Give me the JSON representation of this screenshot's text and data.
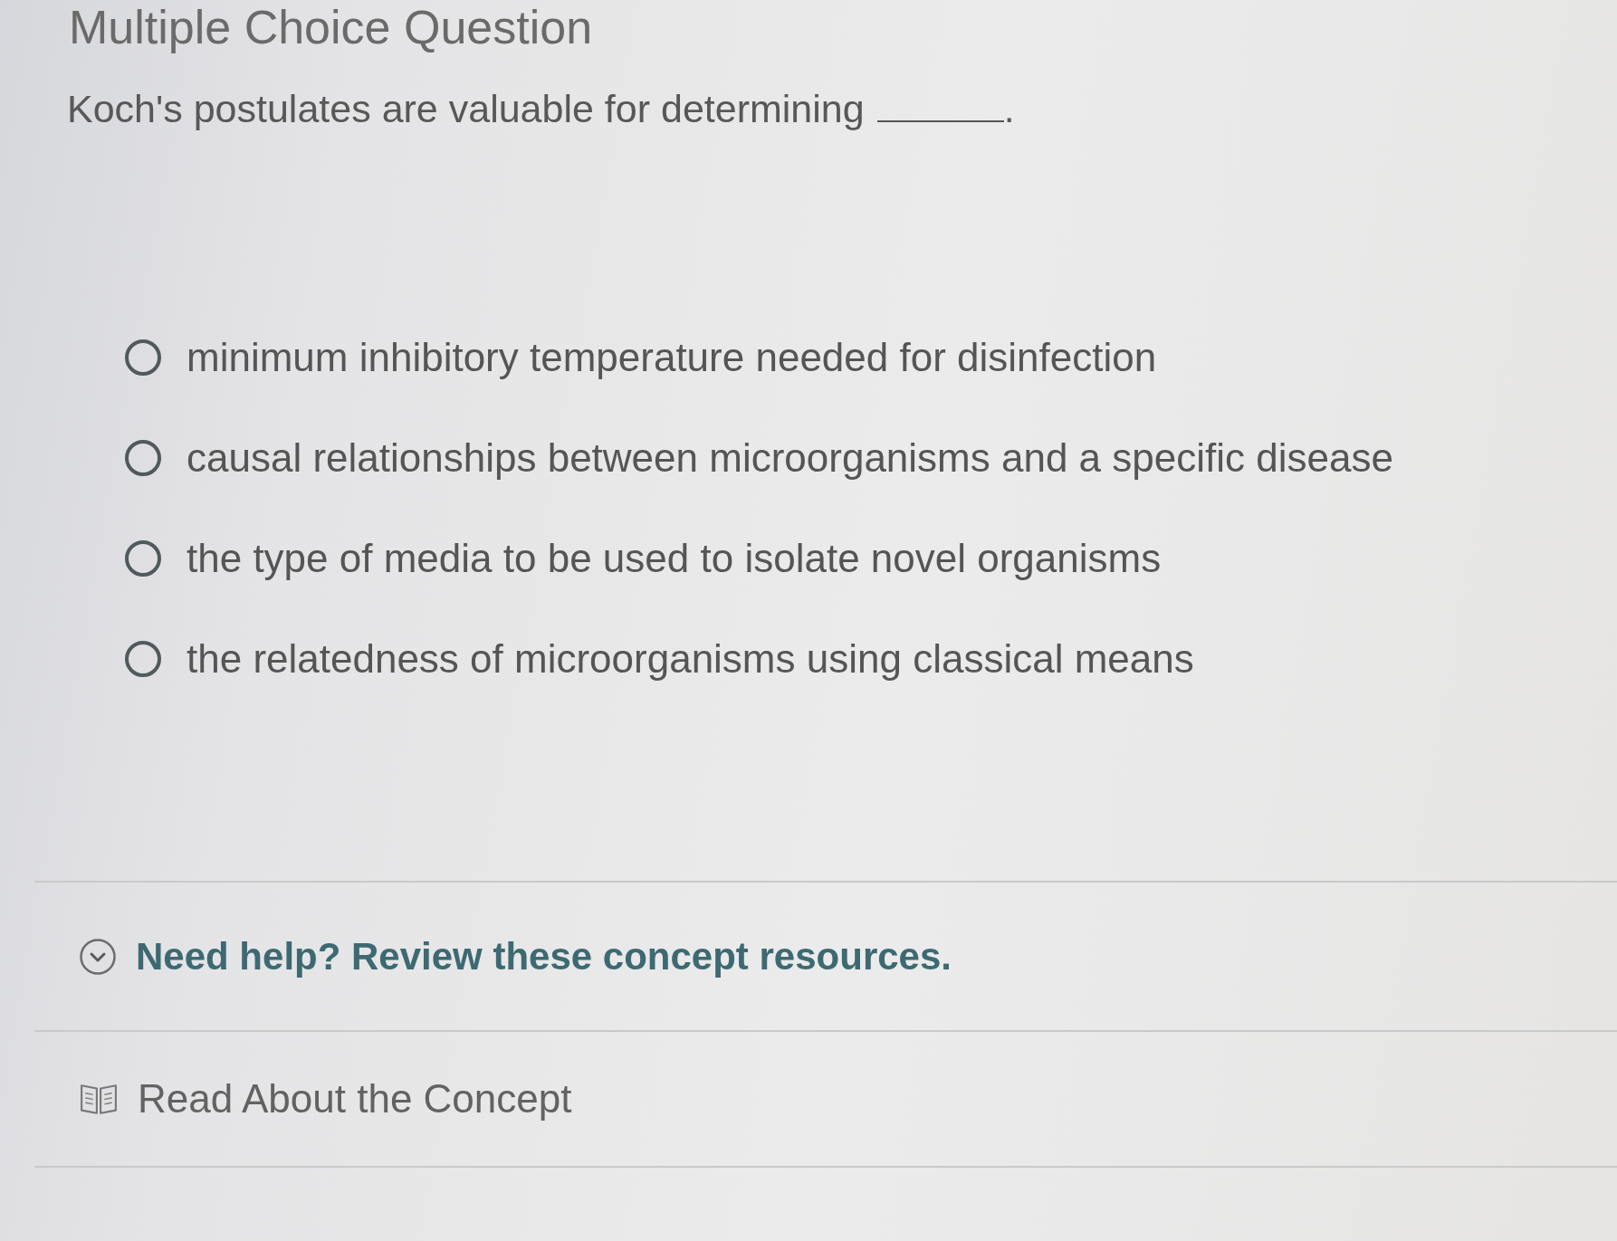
{
  "header": {
    "title": "Multiple Choice Question"
  },
  "question": {
    "text": "Koch's postulates are valuable for determining",
    "after_blank": "."
  },
  "options": [
    {
      "label": "minimum inhibitory temperature needed for disinfection",
      "selected": false
    },
    {
      "label": "causal relationships between microorganisms and a specific disease",
      "selected": false
    },
    {
      "label": "the type of media to be used to isolate novel organisms",
      "selected": false
    },
    {
      "label": "the relatedness of microorganisms using classical means",
      "selected": false
    }
  ],
  "help": {
    "title": "Need help? Review these concept resources.",
    "expanded": true,
    "resources": [
      {
        "label": "Read About the Concept"
      }
    ]
  }
}
